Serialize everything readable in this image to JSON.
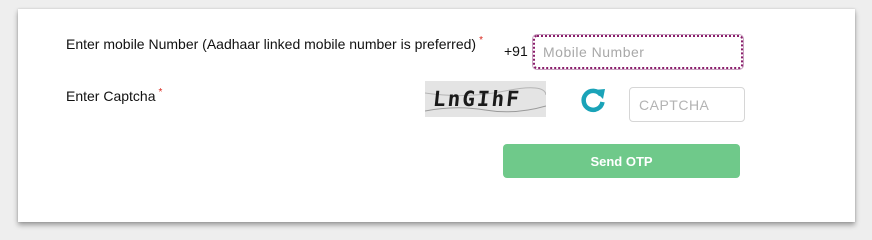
{
  "form": {
    "mobile_label": "Enter mobile Number (Aadhaar linked mobile number is preferred)",
    "captcha_label": "Enter Captcha",
    "required_marker": "*",
    "country_code": "+91",
    "mobile_placeholder": "Mobile Number",
    "mobile_value": "",
    "captcha_text": "LnGIhF",
    "captcha_placeholder": "CAPTCHA",
    "captcha_value": "",
    "send_otp_label": "Send OTP"
  },
  "icons": {
    "refresh": "refresh-icon"
  },
  "colors": {
    "required": "#d9261c",
    "refresh": "#1aa3b8",
    "button": "#6fc98a",
    "focus_border": "#8a1d6a"
  }
}
